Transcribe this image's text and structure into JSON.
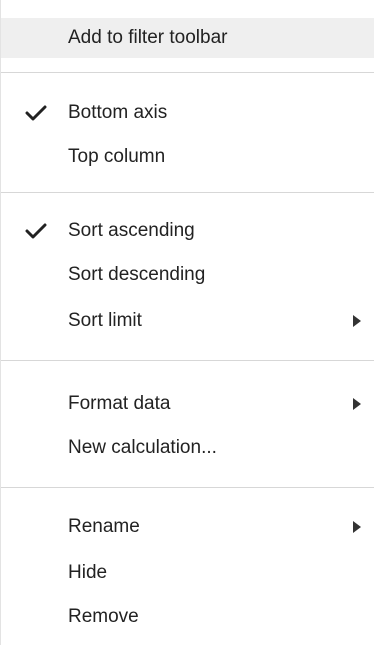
{
  "menu": {
    "items": [
      {
        "label": "Add to filter toolbar"
      },
      {
        "label": "Bottom axis",
        "checked": true
      },
      {
        "label": "Top column"
      },
      {
        "label": "Sort ascending",
        "checked": true
      },
      {
        "label": "Sort descending"
      },
      {
        "label": "Sort limit",
        "submenu": true
      },
      {
        "label": "Format data",
        "submenu": true
      },
      {
        "label": "New calculation..."
      },
      {
        "label": "Rename",
        "submenu": true
      },
      {
        "label": "Hide"
      },
      {
        "label": "Remove"
      }
    ]
  },
  "colors": {
    "highlight": "#efefef",
    "text": "#222222",
    "separator": "#d7d7d7",
    "check": "#222222",
    "arrow": "#333333"
  },
  "icons": {
    "check": "check-icon",
    "submenu": "submenu-arrow-icon"
  }
}
